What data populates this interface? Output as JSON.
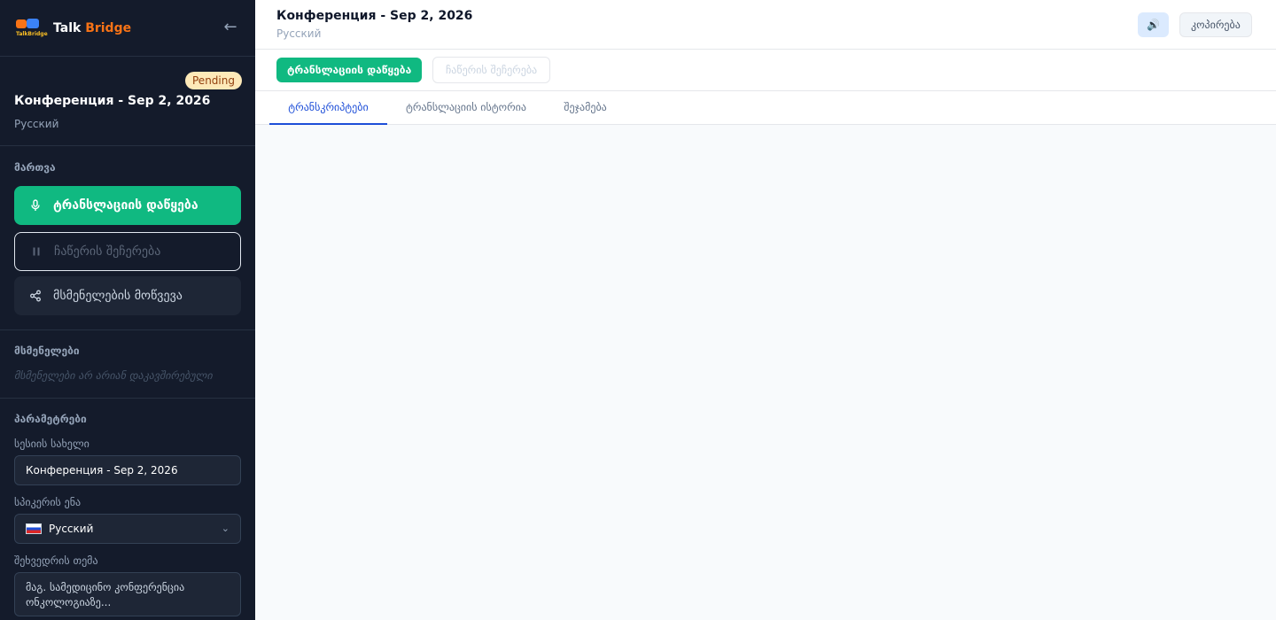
{
  "sidebar": {
    "brand": {
      "word1": "Talk",
      "word2": "Bridge",
      "logo_text": "TalkBridge"
    },
    "back_icon": "arrow-left-icon",
    "session": {
      "status": "Pending",
      "title": "Конференция - Sep 2, 2026",
      "language": "Русский"
    },
    "controls": {
      "label": "მართვა",
      "start_label": "ტრანსლაციის დაწყება",
      "pause_label": "ჩაწერის შეჩერება",
      "invite_label": "მსმენელების მოწვევა"
    },
    "listeners": {
      "label": "მსმენელები",
      "empty_text": "მსმენელები არ არიან დაკავშირებული"
    },
    "params": {
      "label": "პარამეტრები",
      "name_label": "სესიის სახელი",
      "name_value": "Конференция - Sep 2, 2026",
      "lang_label": "სპიკერის ენა",
      "lang_value": "Русский",
      "topic_label": "შეხვედრის თემა",
      "topic_placeholder": "მაგ. სამედიცინო კონფერენცია ონკოლოგიაზე..."
    }
  },
  "main": {
    "title": "Конференция - Sep 2, 2026",
    "language": "Русский",
    "speaker_icon": "speaker-icon",
    "copy_label": "კოპირება",
    "start_label": "ტრანსლაციის დაწყება",
    "pause_label": "ჩაწერის შეჩერება",
    "tabs": [
      {
        "label": "ტრანსკრიპტები",
        "active": true
      },
      {
        "label": "ტრანსლაციის ისტორია",
        "active": false
      },
      {
        "label": "შეჯამება",
        "active": false
      }
    ]
  },
  "colors": {
    "sidebar_bg": "#141b2b",
    "accent_green": "#10b981",
    "brand_orange": "#f97316",
    "tab_active": "#1d4ed8",
    "badge_bg": "#fde9b8"
  }
}
